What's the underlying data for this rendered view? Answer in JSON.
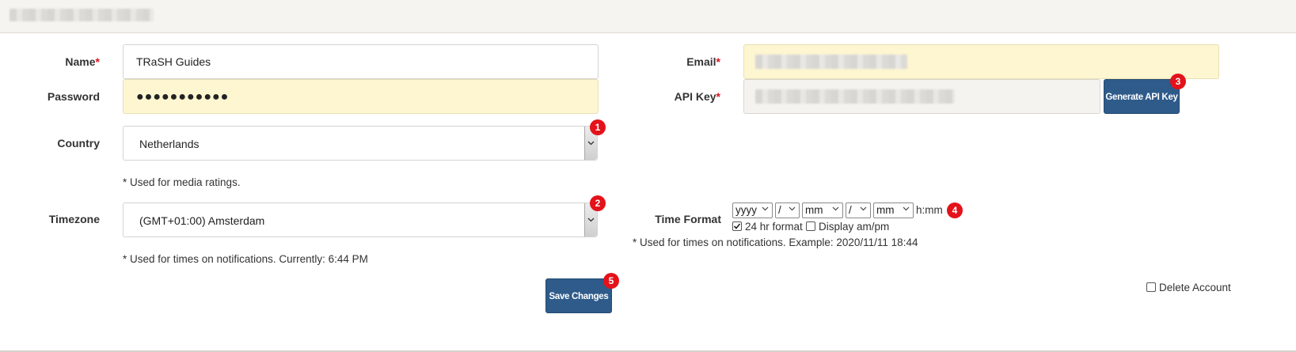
{
  "form": {
    "required_mark": "*",
    "name": {
      "label": "Name",
      "value": "TRaSH Guides"
    },
    "email": {
      "label": "Email"
    },
    "password": {
      "label": "Password",
      "value": "●●●●●●●●●●●"
    },
    "api_key": {
      "label": "API Key",
      "generate_label": "Generate API Key"
    },
    "country": {
      "label": "Country",
      "value": "Netherlands",
      "note": "* Used for media ratings."
    },
    "timezone": {
      "label": "Timezone",
      "value": "(GMT+01:00) Amsterdam",
      "note": "* Used for times on notifications. Currently: 6:44 PM"
    },
    "time_format": {
      "label": "Time Format",
      "parts": [
        "yyyy",
        "/",
        "mm",
        "/",
        "mm"
      ],
      "suffix": "h:mm",
      "hr24_label": "24 hr format",
      "hr24_checked": true,
      "ampm_label": "Display am/pm",
      "ampm_checked": false,
      "note": "* Used for times on notifications. Example: 2020/11/11 18:44"
    },
    "save_label": "Save Changes",
    "delete_label": "Delete Account"
  },
  "badges": [
    "1",
    "2",
    "3",
    "4",
    "5"
  ],
  "colors": {
    "accent_button": "#2e5b8a",
    "badge": "#e4121a",
    "required": "#d9121f",
    "autofill_yellow": "#fdf6d1"
  }
}
